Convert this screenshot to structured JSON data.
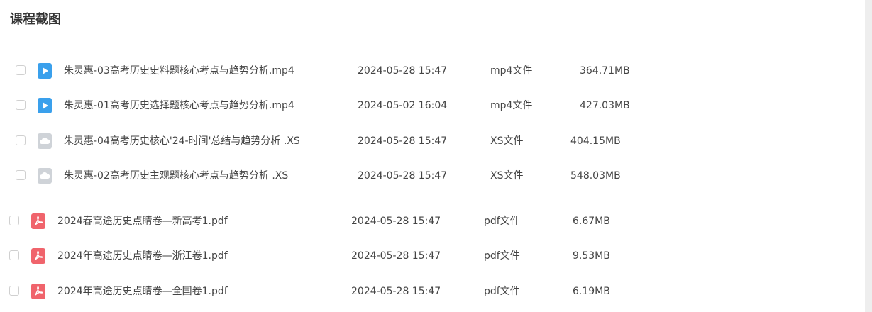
{
  "page_title": "课程截图",
  "colors": {
    "video_icon": "#3aa0ec",
    "doc_icon": "#cfd3d8",
    "pdf_icon": "#f0646c"
  },
  "files": [
    {
      "icon": "video-file-icon",
      "name": "朱灵惠-03高考历史史料题核心考点与趋势分析.mp4",
      "date": "2024-05-28 15:47",
      "type": "mp4文件",
      "size": "364.71MB"
    },
    {
      "icon": "video-file-icon",
      "name": "朱灵惠-01高考历史选择题核心考点与趋势分析.mp4",
      "date": "2024-05-02 16:04",
      "type": "mp4文件",
      "size": "427.03MB"
    },
    {
      "icon": "cloud-file-icon",
      "name": "朱灵惠-04高考历史核心'24-时间'总结与趋势分析  .XS",
      "date": "2024-05-28 15:47",
      "type": "XS文件",
      "size": "404.15MB"
    },
    {
      "icon": "cloud-file-icon",
      "name": "朱灵惠-02高考历史主观题核心考点与趋势分析  .XS",
      "date": "2024-05-28 15:47",
      "type": "XS文件",
      "size": "548.03MB"
    },
    {
      "icon": "pdf-file-icon",
      "name": "2024春高途历史点睛卷—新高考1.pdf",
      "date": "2024-05-28 15:47",
      "type": "pdf文件",
      "size": "6.67MB"
    },
    {
      "icon": "pdf-file-icon",
      "name": "2024年高途历史点睛卷—浙江卷1.pdf",
      "date": "2024-05-28 15:47",
      "type": "pdf文件",
      "size": "9.53MB"
    },
    {
      "icon": "pdf-file-icon",
      "name": "2024年高途历史点睛卷—全国卷1.pdf",
      "date": "2024-05-28 15:47",
      "type": "pdf文件",
      "size": "6.19MB"
    }
  ]
}
